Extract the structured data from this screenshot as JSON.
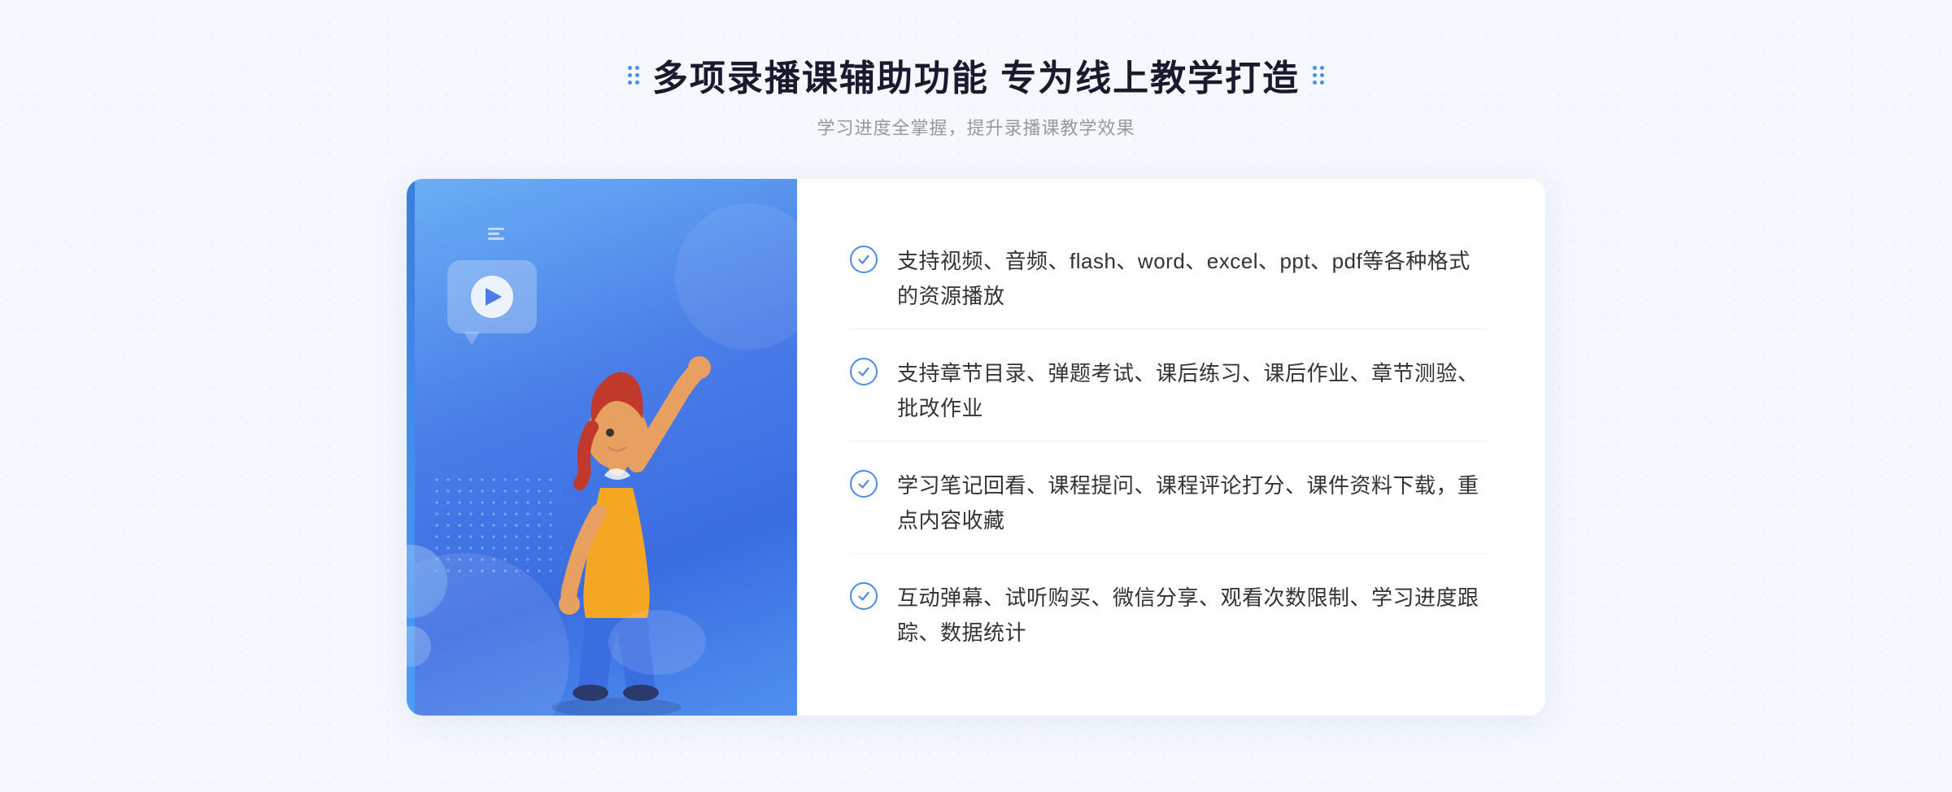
{
  "header": {
    "title": "多项录播课辅助功能 专为线上教学打造",
    "subtitle": "学习进度全掌握，提升录播课教学效果"
  },
  "features": [
    {
      "id": "feature-1",
      "text": "支持视频、音频、flash、word、excel、ppt、pdf等各种格式的资源播放"
    },
    {
      "id": "feature-2",
      "text": "支持章节目录、弹题考试、课后练习、课后作业、章节测验、批改作业"
    },
    {
      "id": "feature-3",
      "text": "学习笔记回看、课程提问、课程评论打分、课件资料下载，重点内容收藏"
    },
    {
      "id": "feature-4",
      "text": "互动弹幕、试听购买、微信分享、观看次数限制、学习进度跟踪、数据统计"
    }
  ]
}
